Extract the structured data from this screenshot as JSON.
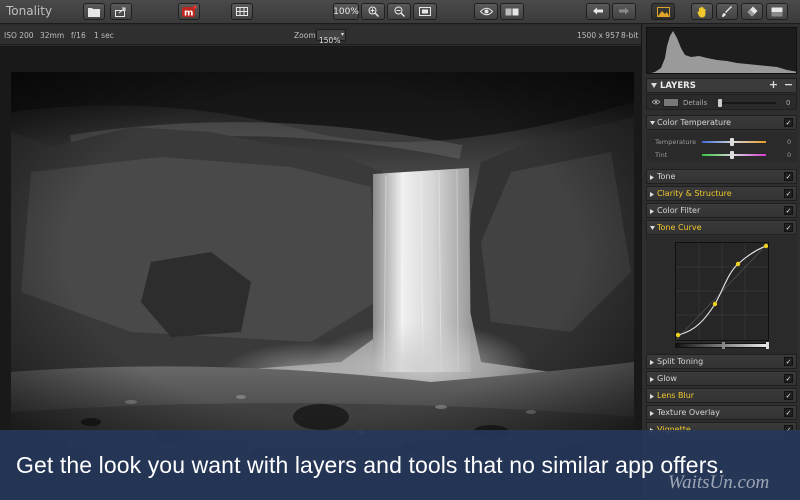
{
  "app": {
    "title": "Tonality"
  },
  "toolbar": {
    "zoom_label": "100%"
  },
  "info": {
    "iso": "ISO 200",
    "focal": "32mm",
    "aperture": "f/16",
    "shutter": "1 sec",
    "zoom_label": "Zoom",
    "zoom_value": "150%",
    "dimensions": "1500 x 957",
    "bit_depth": "8-bit"
  },
  "layers": {
    "title": "LAYERS",
    "add": "+",
    "remove": "−",
    "layer_name": "Details",
    "layer_value": "0",
    "layer_level": 0.0
  },
  "color_temperature": {
    "label": "Color Temperature",
    "temperature_label": "Temperature",
    "temperature_value": "0",
    "tint_label": "Tint",
    "tint_value": "0"
  },
  "sections": {
    "tone": "Tone",
    "clarity": "Clarity & Structure",
    "color_filter": "Color Filter",
    "tone_curve": "Tone Curve",
    "split_toning": "Split Toning",
    "glow": "Glow",
    "lens_blur": "Lens Blur",
    "texture_overlay": "Texture Overlay",
    "vignette": "Vignette"
  },
  "check_mark": "✓",
  "colors": {
    "highlight": "#f0c92e",
    "accent_red": "#c0271e",
    "caption_bg": "#26375c"
  },
  "caption": {
    "text": "Get the look you want with layers and tools that no similar app offers."
  },
  "watermark": {
    "text": "WaitsUn.com"
  }
}
